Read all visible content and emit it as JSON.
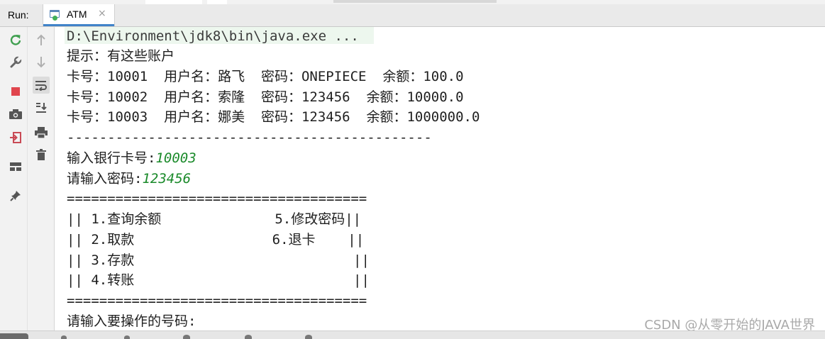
{
  "run_panel": {
    "label": "Run:",
    "tab": {
      "title": "ATM",
      "close_glyph": "×",
      "icon": "run-console-icon"
    }
  },
  "toolbar": {
    "items": [
      {
        "name": "rerun-icon",
        "color": "#3f9f4f"
      },
      {
        "name": "up-arrow-icon",
        "color": "#b0b0b0"
      },
      {
        "name": "wrench-icon",
        "color": "#666666"
      },
      {
        "name": "down-arrow-icon",
        "color": "#b0b0b0"
      },
      {
        "name": "soft-wrap-icon",
        "color": "#555555"
      },
      {
        "name": "stop-icon",
        "color": "#e0454d"
      },
      {
        "name": "scroll-to-end-icon",
        "color": "#555555"
      },
      {
        "name": "camera-icon",
        "color": "#555555"
      },
      {
        "name": "print-icon",
        "color": "#555555"
      },
      {
        "name": "exit-icon",
        "color": "#c94a55"
      },
      {
        "name": "trash-icon",
        "color": "#555555"
      },
      {
        "name": "layout-icon",
        "color": "#555555"
      },
      {
        "name": "pin-icon",
        "color": "#555555"
      }
    ]
  },
  "console": {
    "command": "D:\\Environment\\jdk8\\bin\\java.exe ...",
    "lines": [
      "提示：有这些账户",
      "卡号：10001  用户名：路飞  密码：ONEPIECE  余额：100.0",
      "卡号：10002  用户名：索隆  密码：123456  余额：10000.0",
      "卡号：10003  用户名：娜美  密码：123456  余额：1000000.0",
      "---------------------------------------------"
    ],
    "prompt_card": "输入银行卡号:",
    "input_card": "10003",
    "prompt_password": "请输入密码:",
    "input_password": "123456",
    "menu": [
      "=====================================",
      "|| 1.查询余额              5.修改密码||",
      "|| 2.取款                 6.退卡    ||",
      "|| 3.存款                           ||",
      "|| 4.转账                           ||",
      "====================================="
    ],
    "prompt_operation": "请输入要操作的号码:"
  },
  "watermark": "CSDN @从零开始的JAVA世界",
  "colors": {
    "input_text": "#1a8a2a",
    "command_bg": "#edf7ee",
    "tab_underline": "#4083c9"
  }
}
